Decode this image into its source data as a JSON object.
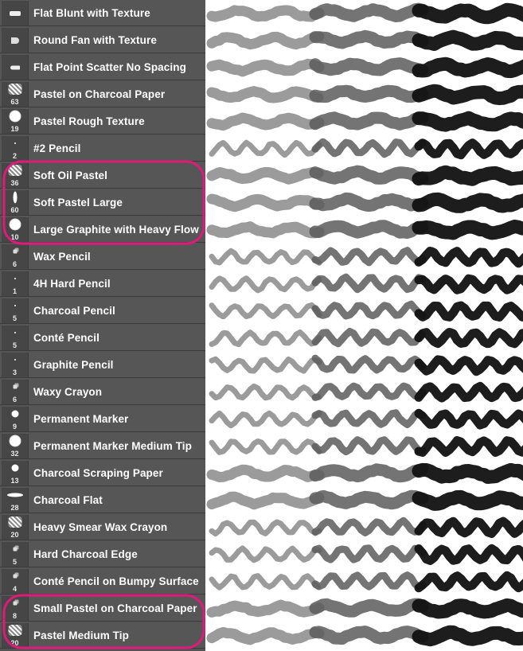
{
  "highlight_color": "#e0197d",
  "brushes": [
    {
      "name": "Flat Blunt with Texture",
      "size": "",
      "tip": "flat-blunt-tip-icon"
    },
    {
      "name": "Round Fan with Texture",
      "size": "",
      "tip": "round-fan-tip-icon"
    },
    {
      "name": "Flat Point Scatter No Spacing",
      "size": "",
      "tip": "flat-point-tip-icon"
    },
    {
      "name": "Pastel on Charcoal Paper",
      "size": "63",
      "tip": "textured-blot-tip-icon"
    },
    {
      "name": "Pastel Rough Texture",
      "size": "19",
      "tip": "round-soft-tip-icon"
    },
    {
      "name": "#2 Pencil",
      "size": "2",
      "tip": "small-dot-tip-icon"
    },
    {
      "name": "Soft Oil Pastel",
      "size": "36",
      "tip": "textured-blot-tip-icon"
    },
    {
      "name": "Soft Pastel Large",
      "size": "60",
      "tip": "ellipse-tip-icon"
    },
    {
      "name": "Large Graphite with Heavy Flow",
      "size": "10",
      "tip": "round-soft-tip-icon"
    },
    {
      "name": "Wax Pencil",
      "size": "6",
      "tip": "scatter-tip-icon"
    },
    {
      "name": "4H Hard Pencil",
      "size": "1",
      "tip": "small-dot-tip-icon"
    },
    {
      "name": "Charcoal Pencil",
      "size": "5",
      "tip": "small-dot-tip-icon"
    },
    {
      "name": "Conté Pencil",
      "size": "5",
      "tip": "small-dot-tip-icon"
    },
    {
      "name": "Graphite Pencil",
      "size": "3",
      "tip": "small-dot-tip-icon"
    },
    {
      "name": "Waxy Crayon",
      "size": "6",
      "tip": "scatter-tip-icon"
    },
    {
      "name": "Permanent Marker",
      "size": "9",
      "tip": "round-hard-tip-icon"
    },
    {
      "name": "Permanent Marker Medium Tip",
      "size": "32",
      "tip": "round-soft-tip-icon"
    },
    {
      "name": "Charcoal Scraping Paper",
      "size": "13",
      "tip": "round-hard-tip-icon"
    },
    {
      "name": "Charcoal Flat",
      "size": "28",
      "tip": "flat-ellipse-tip-icon"
    },
    {
      "name": "Heavy Smear Wax Crayon",
      "size": "20",
      "tip": "textured-blot-tip-icon"
    },
    {
      "name": "Hard Charcoal Edge",
      "size": "5",
      "tip": "scatter-tip-icon"
    },
    {
      "name": "Conté Pencil on Bumpy Surface",
      "size": "4",
      "tip": "scatter-tip-icon"
    },
    {
      "name": "Small Pastel on Charcoal Paper",
      "size": "8",
      "tip": "scatter-tip-icon"
    },
    {
      "name": "Pastel Medium Tip",
      "size": "20",
      "tip": "textured-blot-tip-icon"
    }
  ]
}
